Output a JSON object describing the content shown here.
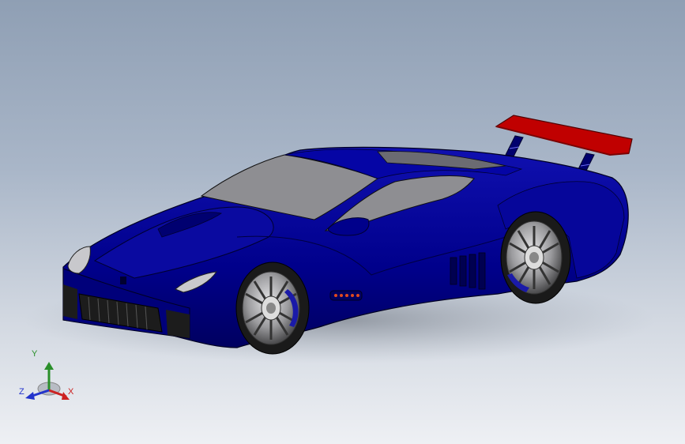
{
  "viewport": {
    "model": "sports-car-assembly",
    "background_top": "#8f9fb4",
    "background_bottom": "#eef0f4"
  },
  "colors": {
    "body": "#00008b",
    "body_shadow": "#000055",
    "glass": "#8e8e92",
    "spoiler": "#c00000",
    "wheel": "#a8a8aa",
    "tire": "#1a1a1a",
    "grille": "#1c1c1c"
  },
  "triad": {
    "y_label": "Y",
    "z_label": "Z",
    "x_label": "X",
    "y_color": "#2a8f2a",
    "z_color": "#2233cc",
    "x_color": "#cc2222"
  }
}
